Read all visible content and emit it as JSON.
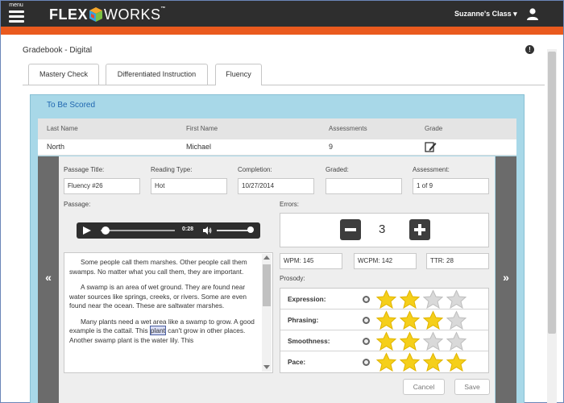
{
  "header": {
    "menu_label": "menu",
    "logo_part1": "FLEX",
    "logo_part2": "WORKS",
    "logo_tm": "™",
    "class_menu": "Suzanne's Class ▾"
  },
  "page": {
    "title": "Gradebook - Digital"
  },
  "tabs": [
    {
      "label": "Mastery Check"
    },
    {
      "label": "Differentiated Instruction"
    },
    {
      "label": "Fluency",
      "active": true
    }
  ],
  "panel": {
    "title": "To Be Scored",
    "columns": [
      "Last Name",
      "First Name",
      "Assessments",
      "Grade"
    ],
    "row": {
      "last_name": "North",
      "first_name": "Michael",
      "assessments": "9"
    }
  },
  "nav": {
    "prev": "«",
    "next": "»"
  },
  "fields": {
    "passage_title": {
      "label": "Passage Title:",
      "value": "Fluency #26"
    },
    "reading_type": {
      "label": "Reading Type:",
      "value": "Hot"
    },
    "completion": {
      "label": "Completion:",
      "value": "10/27/2014"
    },
    "graded": {
      "label": "Graded:",
      "value": ""
    },
    "assessment": {
      "label": "Assessment:",
      "value": "1 of 9"
    }
  },
  "passage": {
    "label": "Passage:",
    "audio_time": "0:28",
    "p1": "Some people call them marshes. Other people call them swamps. No matter what you call them, they are important.",
    "p2": "A swamp is an area of wet ground. They are found near water sources like springs, creeks, or rivers. Some are even found near the ocean. These are saltwater marshes.",
    "p3_before": "Many plants need a wet area like a swamp to grow. A good example is the cattail. This ",
    "p3_highlight": "plant",
    "p3_after": " can't grow in other places. Another swamp plant is the water lily. This"
  },
  "errors": {
    "label": "Errors:",
    "value": "3"
  },
  "metrics": {
    "wpm": "WPM: 145",
    "wcpm": "WCPM: 142",
    "ttr": "TTR: 28"
  },
  "prosody": {
    "label": "Prosody:",
    "rows": [
      {
        "label": "Expression:",
        "rating": 2,
        "max": 4
      },
      {
        "label": "Phrasing:",
        "rating": 3,
        "max": 4
      },
      {
        "label": "Smoothness:",
        "rating": 2,
        "max": 4
      },
      {
        "label": "Pace:",
        "rating": 4,
        "max": 4
      }
    ]
  },
  "buttons": {
    "cancel": "Cancel",
    "save": "Save"
  },
  "colors": {
    "accent_orange": "#ea5a1e",
    "star_filled": "#f5cf1a",
    "star_empty": "#d9d9d9",
    "panel_blue": "#a8d8e8",
    "title_blue": "#1f66b0"
  }
}
